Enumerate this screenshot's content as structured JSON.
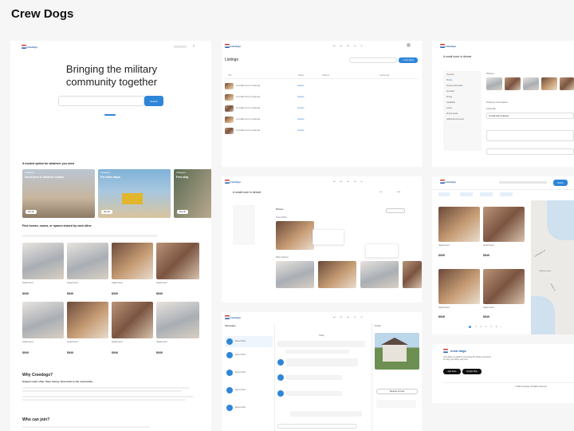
{
  "header": {
    "title": "Crew Dogs"
  },
  "brand": {
    "name": "crewdogs",
    "footer_name": "crew dogs",
    "accent": "#2f86d8"
  },
  "home": {
    "hero": "Bringing the military community together",
    "search_button": "Search",
    "trusted": "A trusted option for whatever you need",
    "categories": [
      {
        "tag": "Category",
        "name": "Short-term & Vacation rentals",
        "btn": "See all"
      },
      {
        "tag": "Category",
        "name": "Pet sitter stays",
        "btn": "See all"
      },
      {
        "tag": "Category",
        "name": "Free stay",
        "btn": "See all"
      }
    ],
    "find": "Find homes, rooms, or spaces shared by each other",
    "listings_row1": [
      {
        "type": "Apartment",
        "price": "$949"
      },
      {
        "type": "Apartment",
        "price": "$949"
      },
      {
        "type": "Apartment",
        "price": "$949"
      },
      {
        "type": "Apartment",
        "price": "$949"
      }
    ],
    "listings_row2": [
      {
        "type": "Apartment",
        "price": "$949"
      },
      {
        "type": "Apartment",
        "price": "$949"
      },
      {
        "type": "Apartment",
        "price": "$949"
      },
      {
        "type": "Apartment",
        "price": "$949"
      }
    ],
    "why": "Why Creedogs?",
    "why_sub": "Support each other. Save money. Give back to the community.",
    "join": "Who can join?"
  },
  "listings_page": {
    "title": "Listings",
    "new_button": "+ New listing",
    "columns": [
      "Title",
      "Status",
      "Address",
      "Listing type"
    ],
    "rows": [
      {
        "title": "A small room in denver",
        "status": "Inactive"
      },
      {
        "title": "A small room in denver",
        "status": "Inactive"
      },
      {
        "title": "A small room in denver",
        "status": "Inactive"
      },
      {
        "title": "A small room in denver",
        "status": "Inactive"
      },
      {
        "title": "A small room in denver",
        "status": "Inactive"
      }
    ]
  },
  "edit_page": {
    "title": "A small room in denver",
    "photos_label": "Photos",
    "property_label": "Property information",
    "listing_title_label": "Listing title",
    "listing_title_value": "A small room in denver",
    "menu": [
      "Overview",
      "Photos",
      "Property information",
      "Amenities",
      "Pricing",
      "Availability",
      "Listing",
      "Photos details",
      "Additional documents"
    ]
  },
  "photos_page": {
    "title": "A small room in denver",
    "photos_label": "Photos",
    "cover_label": "Cover photo",
    "other_label": "Other pictures"
  },
  "messages_page": {
    "title": "Messages",
    "today": "Today",
    "send": "Send",
    "contacts": [
      "Steven Pass",
      "Steven Pass",
      "Steven Pass",
      "Steven Pass",
      "Steven Pass"
    ],
    "details": "Details",
    "request_btn": "Request to book"
  },
  "map_page": {
    "search_button": "Search",
    "cards": [
      {
        "type": "Apartment",
        "price": "$949"
      },
      {
        "type": "Apartment",
        "price": "$949"
      },
      {
        "type": "Apartment",
        "price": "$949"
      },
      {
        "type": "Apartment",
        "price": "$949"
      }
    ],
    "pages": [
      "1",
      "2",
      "3",
      "4",
      "5",
      "6"
    ],
    "streets": [
      "E Woodward St",
      "E Adamson Ave",
      "N Main St"
    ]
  },
  "footer_page": {
    "desc": "Crew Dogs is a platform connecting the military community for stays, pet sitting, and more.",
    "app_store": "App Store",
    "google_play": "Google Play",
    "copyright": "© 2022 Crewdogs. All Rights Reserved."
  }
}
